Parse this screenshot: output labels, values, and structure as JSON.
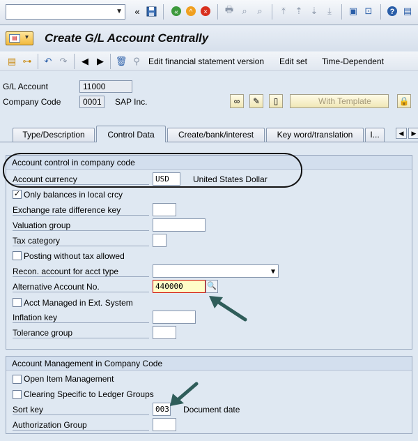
{
  "title": "Create G/L Account Centrally",
  "toolbar": {
    "command_field": ""
  },
  "app_toolbar": {
    "edit_fs_version": "Edit financial statement version",
    "edit_set": "Edit set",
    "time_dependent": "Time-Dependent"
  },
  "header": {
    "gl_account_label": "G/L Account",
    "gl_account_value": "11000",
    "company_code_label": "Company Code",
    "company_code_value": "0001",
    "company_name": "SAP Inc.",
    "with_template": "With Template"
  },
  "tabs": [
    {
      "label": "Type/Description"
    },
    {
      "label": "Control Data"
    },
    {
      "label": "Create/bank/interest"
    },
    {
      "label": "Key word/translation"
    },
    {
      "label": "I..."
    }
  ],
  "group1": {
    "title": "Account control in company code",
    "account_currency_label": "Account currency",
    "account_currency_value": "USD",
    "currency_name": "United States Dollar",
    "only_balances_label": "Only balances in local crcy",
    "exchange_rate_label": "Exchange rate difference key",
    "valuation_group_label": "Valuation group",
    "tax_category_label": "Tax category",
    "posting_without_tax_label": "Posting without tax allowed",
    "recon_account_label": "Recon. account for acct type",
    "alt_account_label": "Alternative Account No.",
    "alt_account_value": "440000",
    "acct_managed_label": "Acct Managed in Ext. System",
    "inflation_key_label": "Inflation key",
    "tolerance_group_label": "Tolerance group"
  },
  "group2": {
    "title": "Account Management in Company Code",
    "open_item_label": "Open Item Management",
    "clearing_specific_label": "Clearing Specific to Ledger Groups",
    "sort_key_label": "Sort key",
    "sort_key_value": "003",
    "sort_key_desc": "Document date",
    "auth_group_label": "Authorization Group"
  },
  "colors": {
    "annotation_arrow": "#2f5d5a",
    "highlight_border": "#cc0000"
  }
}
